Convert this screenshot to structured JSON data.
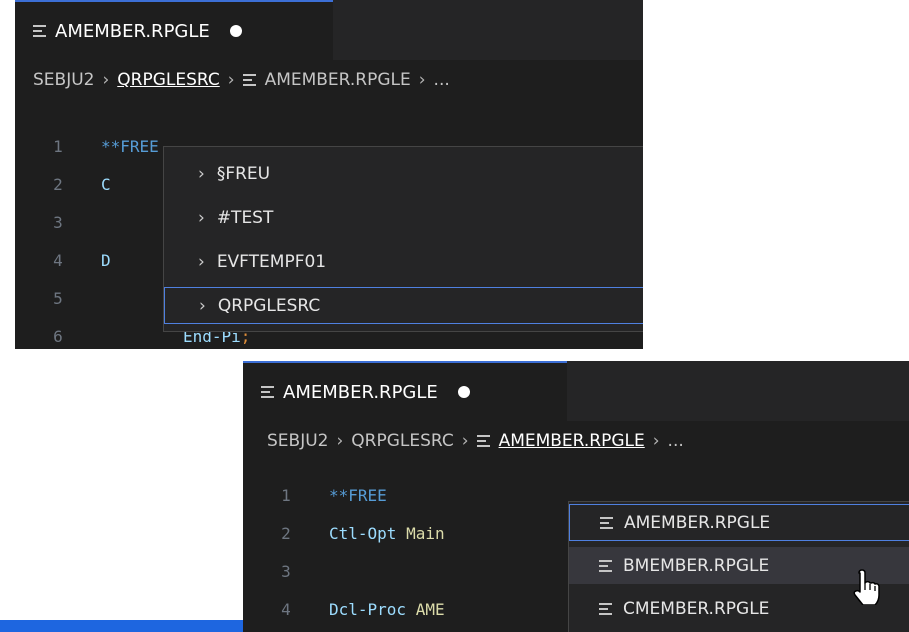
{
  "panels": [
    {
      "tab_title": "AMEMBER.RPGLE",
      "breadcrumb": {
        "segments": [
          "SEBJU2",
          "QRPGLESRC"
        ],
        "file": "AMEMBER.RPGLE",
        "tail": "..."
      },
      "code_lines": [
        {
          "num": "1",
          "text": "**FREE"
        },
        {
          "num": "2",
          "text": "C"
        },
        {
          "num": "3",
          "text": ""
        },
        {
          "num": "4",
          "text": "D"
        },
        {
          "num": "5",
          "text": ""
        },
        {
          "num": "6",
          "text": "End-Pi",
          "semi": ";"
        }
      ],
      "dropdown_items": [
        "§FREU",
        "#TEST",
        "EVFTEMPF01",
        "QRPGLESRC"
      ]
    },
    {
      "tab_title": "AMEMBER.RPGLE",
      "breadcrumb": {
        "segments": [
          "SEBJU2",
          "QRPGLESRC"
        ],
        "file": "AMEMBER.RPGLE",
        "tail": "..."
      },
      "code_lines": [
        {
          "num": "1",
          "kw": "**FREE",
          "rest": ""
        },
        {
          "num": "2",
          "kw": "Ctl-Opt",
          "rest": " Main"
        },
        {
          "num": "3",
          "kw": "",
          "rest": ""
        },
        {
          "num": "4",
          "kw": "Dcl-Proc",
          "rest": " AME"
        }
      ],
      "dropdown_items": [
        "AMEMBER.RPGLE",
        "BMEMBER.RPGLE",
        "CMEMBER.RPGLE"
      ]
    }
  ],
  "colors": {
    "accent": "#3c6fd6",
    "editor_bg": "#1e1e1e",
    "bottom_bar": "#1e66e0"
  },
  "icons": [
    "file-lines-icon",
    "chevron-right-icon",
    "hand-cursor-icon"
  ]
}
